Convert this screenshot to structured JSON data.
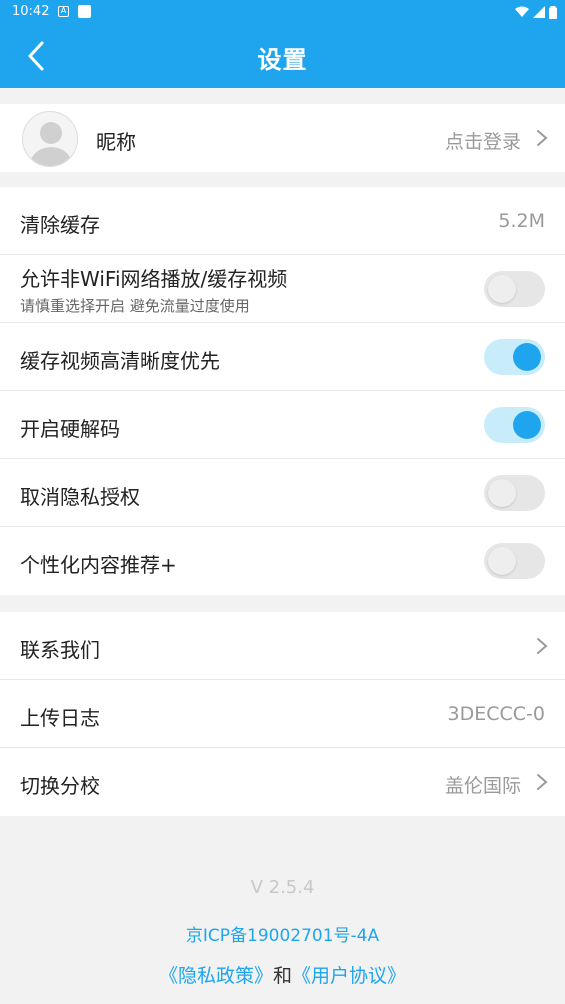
{
  "status_bar": {
    "time": "10:42",
    "icon1": "A"
  },
  "header": {
    "title": "设置"
  },
  "profile": {
    "nickname_label": "昵称",
    "login_text": "点击登录"
  },
  "settings": {
    "clear_cache": {
      "label": "清除缓存",
      "value": "5.2M"
    },
    "non_wifi": {
      "label": "允许非WiFi网络播放/缓存视频",
      "sub": "请慎重选择开启 避免流量过度使用",
      "on": false
    },
    "hd_cache": {
      "label": "缓存视频高清晰度优先",
      "on": true
    },
    "hw_decode": {
      "label": "开启硬解码",
      "on": true
    },
    "privacy_revoke": {
      "label": "取消隐私授权",
      "on": false
    },
    "personalized": {
      "label": "个性化内容推荐+",
      "on": false
    }
  },
  "misc": {
    "contact": {
      "label": "联系我们"
    },
    "upload_log": {
      "label": "上传日志",
      "value": "3DECCC-0"
    },
    "switch_campus": {
      "label": "切换分校",
      "value": "盖伦国际"
    }
  },
  "footer": {
    "version": "V 2.5.4",
    "icp": "京ICP备19002701号-4A",
    "privacy_link": "《隐私政策》",
    "and_text": "和",
    "user_agreement_link": "《用户协议》"
  },
  "colors": {
    "accent": "#1ea5ee",
    "toggle_on_track": "#c9ecfb",
    "toggle_off_track": "#e6e6e6"
  }
}
